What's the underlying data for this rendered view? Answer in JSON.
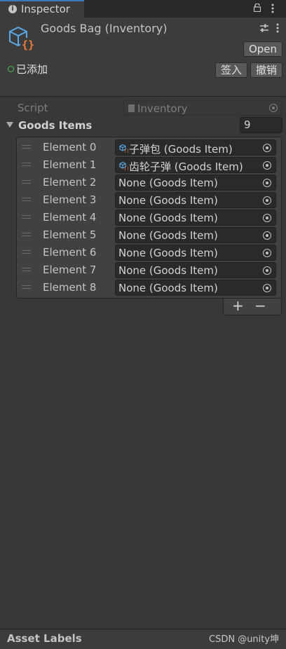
{
  "tab": {
    "label": "Inspector"
  },
  "header": {
    "title": "Goods Bag (Inventory)",
    "open_label": "Open",
    "status_label": "已添加",
    "checkin_label": "签入",
    "revert_label": "撤销"
  },
  "script": {
    "label": "Script",
    "value": "Inventory"
  },
  "goods_items": {
    "label": "Goods Items",
    "size": "9",
    "elements": [
      {
        "label": "Element 0",
        "value": "子弹包 (Goods Item)",
        "icon": "scriptable-object-icon"
      },
      {
        "label": "Element 1",
        "value": "齿轮子弹 (Goods Item)",
        "icon": "scriptable-object-icon"
      },
      {
        "label": "Element 2",
        "value": "None (Goods Item)"
      },
      {
        "label": "Element 3",
        "value": "None (Goods Item)"
      },
      {
        "label": "Element 4",
        "value": "None (Goods Item)"
      },
      {
        "label": "Element 5",
        "value": "None (Goods Item)"
      },
      {
        "label": "Element 6",
        "value": "None (Goods Item)"
      },
      {
        "label": "Element 7",
        "value": "None (Goods Item)"
      },
      {
        "label": "Element 8",
        "value": "None (Goods Item)"
      }
    ],
    "add_label": "+",
    "remove_label": "−"
  },
  "footer": {
    "label": "Asset Labels",
    "watermark": "CSDN @unity坤"
  },
  "colors": {
    "accent": "#3a79bb",
    "status_green": "#4bbf5a",
    "icon_blue": "#5aa9e6",
    "icon_orange": "#f07b3f"
  }
}
